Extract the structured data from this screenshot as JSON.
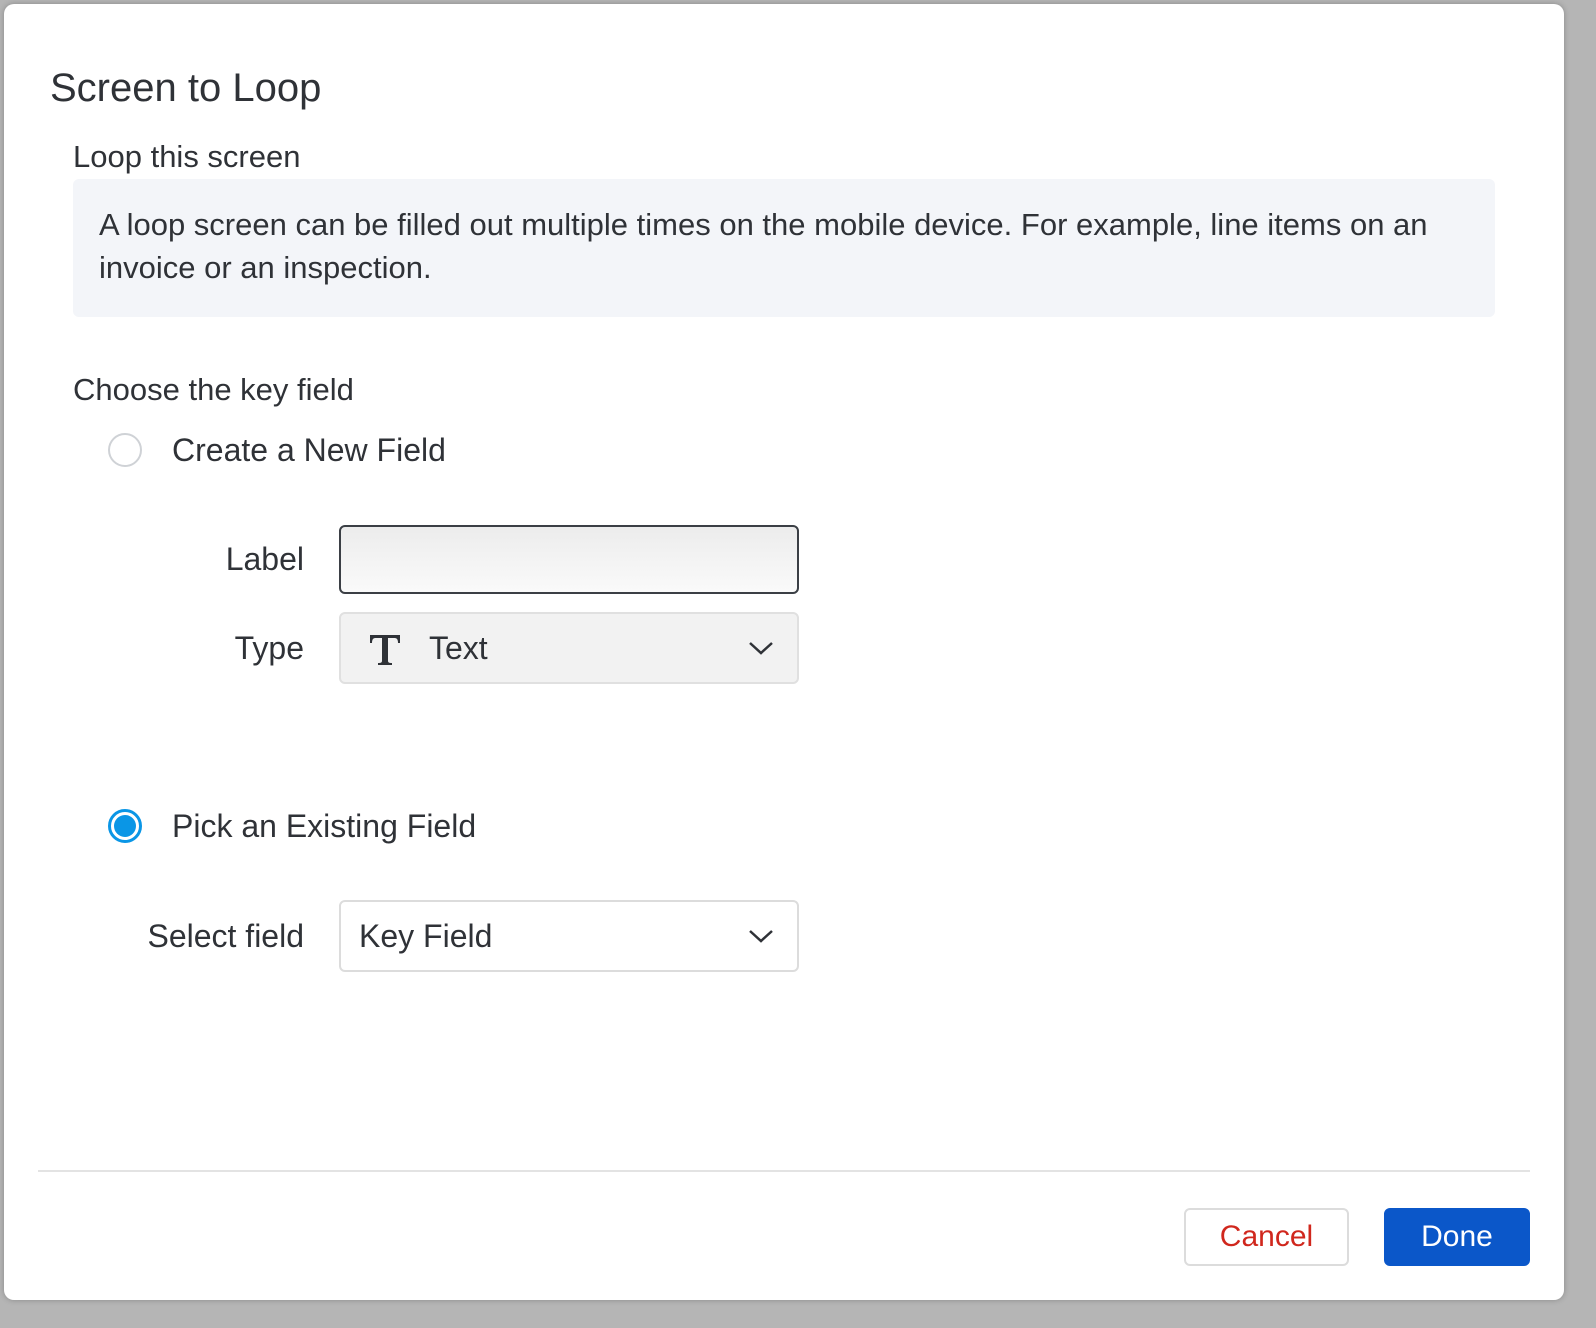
{
  "dialog": {
    "title": "Screen to Loop",
    "loop_heading": "Loop this screen",
    "info_text": "A loop screen can be filled out multiple times on the mobile device. For example, line items on an invoice or an inspection.",
    "key_field_heading": "Choose the key field"
  },
  "options": {
    "new_field": {
      "label": "Create a New Field",
      "checked": false,
      "label_field_caption": "Label",
      "label_field_value": "",
      "type_caption": "Type",
      "type_value": "Text",
      "type_icon": "text-type-icon"
    },
    "existing_field": {
      "label": "Pick an Existing Field",
      "checked": true,
      "select_caption": "Select field",
      "select_value": "Key Field"
    }
  },
  "footer": {
    "cancel_label": "Cancel",
    "done_label": "Done"
  },
  "colors": {
    "accent_radio": "#0a96e6",
    "primary_button": "#0b57c9",
    "cancel_text": "#d0271d",
    "info_background": "#f3f5f9"
  }
}
